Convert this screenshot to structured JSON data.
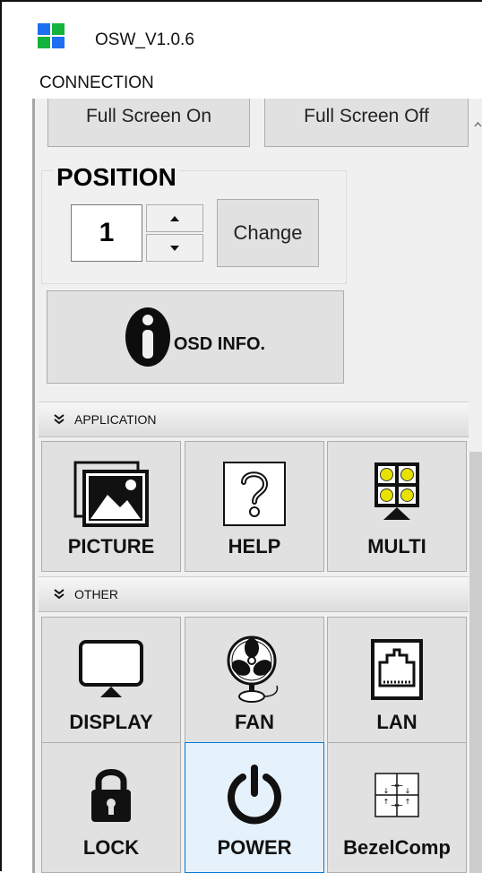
{
  "window": {
    "title": "OSW_V1.0.6"
  },
  "menu": {
    "connection_label": "CONNECTION"
  },
  "fullscreen": {
    "on_label": "Full Screen On",
    "off_label": "Full Screen Off"
  },
  "position": {
    "label": "POSITION",
    "value": "1",
    "change_label": "Change"
  },
  "osd": {
    "label": "OSD INFO."
  },
  "sections": {
    "application": "APPLICATION",
    "other": "OTHER"
  },
  "application_tiles": [
    {
      "label": "PICTURE",
      "icon": "picture-icon"
    },
    {
      "label": "HELP",
      "icon": "help-icon"
    },
    {
      "label": "MULTI",
      "icon": "multi-icon"
    }
  ],
  "other_tiles": [
    {
      "label": "DISPLAY",
      "icon": "display-icon"
    },
    {
      "label": "FAN",
      "icon": "fan-icon"
    },
    {
      "label": "LAN",
      "icon": "lan-icon"
    },
    {
      "label": "LOCK",
      "icon": "lock-icon"
    },
    {
      "label": "POWER",
      "icon": "power-icon",
      "selected": true
    },
    {
      "label": "BezelComp",
      "icon": "bezel-comp-icon"
    }
  ],
  "colors": {
    "app_icon": [
      "#1e6ff0",
      "#14b43c",
      "#14b43c",
      "#1e6ff0"
    ],
    "selected_tile": "#e5f1fb",
    "selected_border": "#0078d7"
  }
}
